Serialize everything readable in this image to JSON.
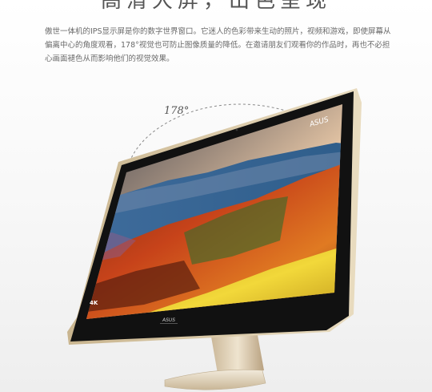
{
  "heading": "高清大屏，出色呈现",
  "description": "傲世一体机的IPS显示屏是你的数字世界窗口。它迷人的色彩带来生动的照片，视频和游戏，即使屏幕从偏离中心的角度观看，178°视觉也可防止图像质量的降低。在邀请朋友们观看你的作品时，再也不必担心画面褪色从而影响他们的视觉效果。",
  "angle_label": "178°",
  "screen_logo": "ASUS",
  "bezel_logo": "ASUS",
  "screen_badge": "4K"
}
